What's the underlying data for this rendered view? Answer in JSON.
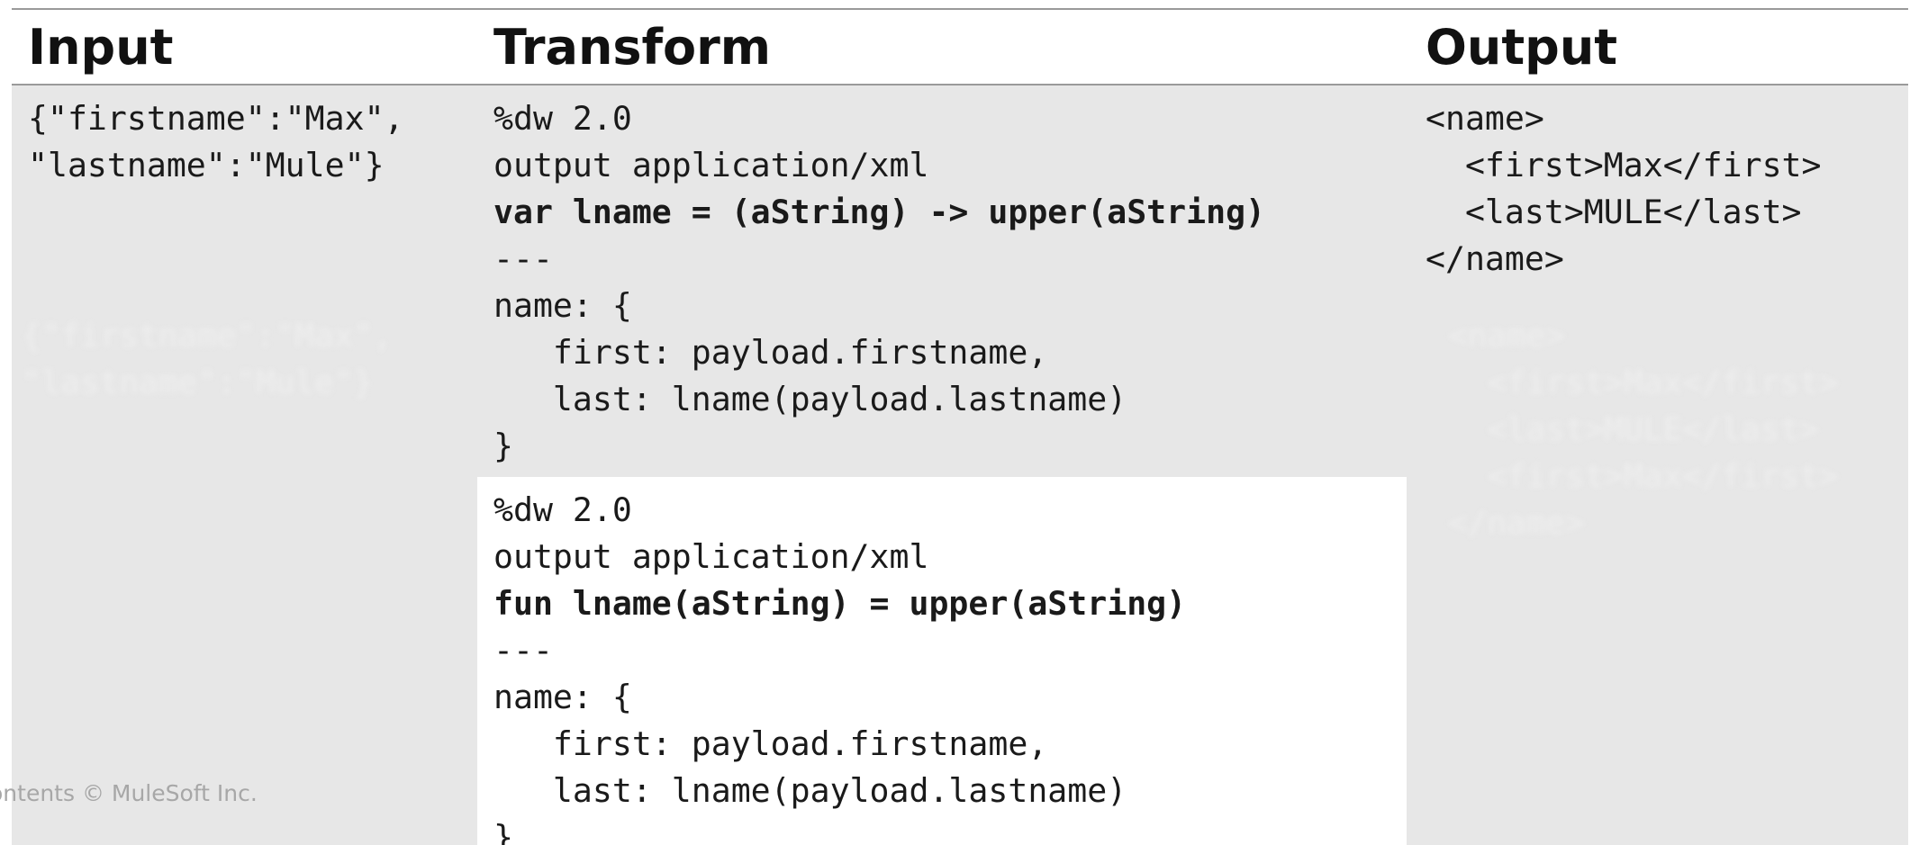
{
  "headers": {
    "input": "Input",
    "transform": "Transform",
    "output": "Output"
  },
  "input_code": [
    "{\"firstname\":\"Max\",",
    "\"lastname\":\"Mule\"}"
  ],
  "transform_var_code": [
    "%dw 2.0",
    "output application/xml",
    "var lname = (aString) -> upper(aString)",
    "---",
    "name: {",
    "   first: payload.firstname,",
    "   last: lname(payload.lastname)",
    "}"
  ],
  "transform_fun_code": [
    "%dw 2.0",
    "output application/xml",
    "fun lname(aString) = upper(aString)",
    "---",
    "name: {",
    "   first: payload.firstname,",
    "   last: lname(payload.lastname)",
    "}"
  ],
  "output_code": [
    "<name>",
    "  <first>Max</first>",
    "  <last>MULE</last>",
    "</name>"
  ],
  "footer": {
    "copyright": "ontents © MuleSoft Inc."
  },
  "colors": {
    "table_body": "#e7e7e7",
    "highlight_box": "#ffffff",
    "rule": "#9a9a9a",
    "text": "#111111"
  }
}
